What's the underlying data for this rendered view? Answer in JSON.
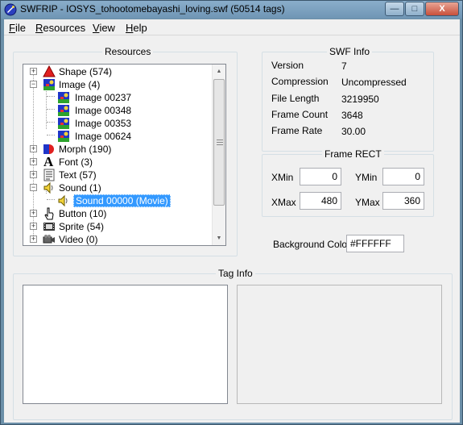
{
  "window": {
    "title": "SWFRIP - IOSYS_tohootomebayashi_loving.swf (50514 tags)",
    "controls": {
      "minimize": "—",
      "maximize": "□",
      "close": "X"
    }
  },
  "menu": [
    {
      "label": "File",
      "mnemonic": "F",
      "rest": "ile"
    },
    {
      "label": "Resources",
      "mnemonic": "R",
      "rest": "esources"
    },
    {
      "label": "View",
      "mnemonic": "V",
      "rest": "iew"
    },
    {
      "label": "Help",
      "mnemonic": "H",
      "rest": "elp"
    }
  ],
  "resources": {
    "title": "Resources",
    "tree": [
      {
        "label": "Shape (574)",
        "icon": "shape-icon",
        "expander": "+"
      },
      {
        "label": "Image (4)",
        "icon": "image-icon",
        "expander": "−"
      },
      {
        "label": "Image 00237",
        "icon": "image-icon"
      },
      {
        "label": "Image 00348",
        "icon": "image-icon"
      },
      {
        "label": "Image 00353",
        "icon": "image-icon"
      },
      {
        "label": "Image 00624",
        "icon": "image-icon"
      },
      {
        "label": "Morph (190)",
        "icon": "morph-icon",
        "expander": "+"
      },
      {
        "label": "Font (3)",
        "icon": "font-icon",
        "expander": "+",
        "glyph": "A"
      },
      {
        "label": "Text (57)",
        "icon": "text-icon",
        "expander": "+"
      },
      {
        "label": "Sound (1)",
        "icon": "sound-icon",
        "expander": "−"
      },
      {
        "label": "Sound 00000  (Movie)",
        "icon": "sound-icon",
        "selected": true
      },
      {
        "label": "Button (10)",
        "icon": "button-icon",
        "expander": "+"
      },
      {
        "label": "Sprite (54)",
        "icon": "sprite-icon",
        "expander": "+"
      },
      {
        "label": "Video (0)",
        "icon": "video-icon",
        "expander": "+"
      }
    ],
    "scroll": {
      "up": "▲",
      "down": "▼"
    }
  },
  "swf_info": {
    "title": "SWF Info",
    "version_label": "Version",
    "version": "7",
    "compression_label": "Compression",
    "compression": "Uncompressed",
    "file_length_label": "File Length",
    "file_length": "3219950",
    "frame_count_label": "Frame Count",
    "frame_count": "3648",
    "frame_rate_label": "Frame Rate",
    "frame_rate": "30.00"
  },
  "frame_rect": {
    "title": "Frame RECT",
    "xmin_label": "XMin",
    "xmin": "0",
    "ymin_label": "YMin",
    "ymin": "0",
    "xmax_label": "XMax",
    "xmax": "480",
    "ymax_label": "YMax",
    "ymax": "360"
  },
  "background": {
    "label": "Background Color",
    "value": "#FFFFFF"
  },
  "tag_info": {
    "title": "Tag Info"
  },
  "colors": {
    "titlebar": "#7ea2c0",
    "selection": "#3399ff",
    "dialog": "#f0f0f0"
  }
}
